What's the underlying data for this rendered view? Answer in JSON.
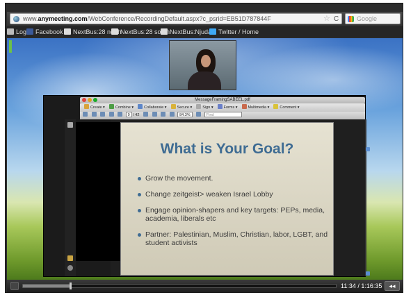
{
  "browser": {
    "url_prefix": "www.",
    "url_domain": "anymeeting.com",
    "url_path": "/WebConference/RecordingDefault.aspx?c_psrid=EB51D787844F",
    "search_placeholder": "Google"
  },
  "bookmarks": [
    {
      "label": "Login",
      "icon": "globe-icon",
      "color": "#bbbbbb"
    },
    {
      "label": "Facebook",
      "icon": "facebook-icon",
      "color": "#3b5998"
    },
    {
      "label": "NextBus:28 north",
      "icon": "bus-icon",
      "color": "#dddddd"
    },
    {
      "label": "NextBus:28 south",
      "icon": "bus-icon",
      "color": "#dddddd"
    },
    {
      "label": "NextBus:Njudah",
      "icon": "bus-icon",
      "color": "#dddddd"
    },
    {
      "label": "Twitter / Home",
      "icon": "twitter-bird-icon",
      "color": "#3fa9f5"
    }
  ],
  "app": {
    "window_title": "MessageFramingSABEEL.pdf",
    "toolbar1": [
      "Create",
      "Combine",
      "Collaborate",
      "Secure",
      "Sign",
      "Forms",
      "Multimedia",
      "Comment"
    ],
    "page_current": "9",
    "page_total": "/ 42",
    "zoom": "84.3%",
    "find_placeholder": "Find"
  },
  "slide": {
    "title": "What is Your Goal?",
    "bullets": [
      "Grow the movement.",
      "Change zeitgeist> weaken Israel Lobby",
      "Engage opinion-shapers and key targets: PEPs, media, academia, liberals etc",
      "Partner: Palestinian, Muslim, Christian, labor, LGBT, and student activists"
    ]
  },
  "player": {
    "time": "11:34 / 1:16:35",
    "progress": 0.151,
    "volume_icon": "speaker-icon"
  }
}
